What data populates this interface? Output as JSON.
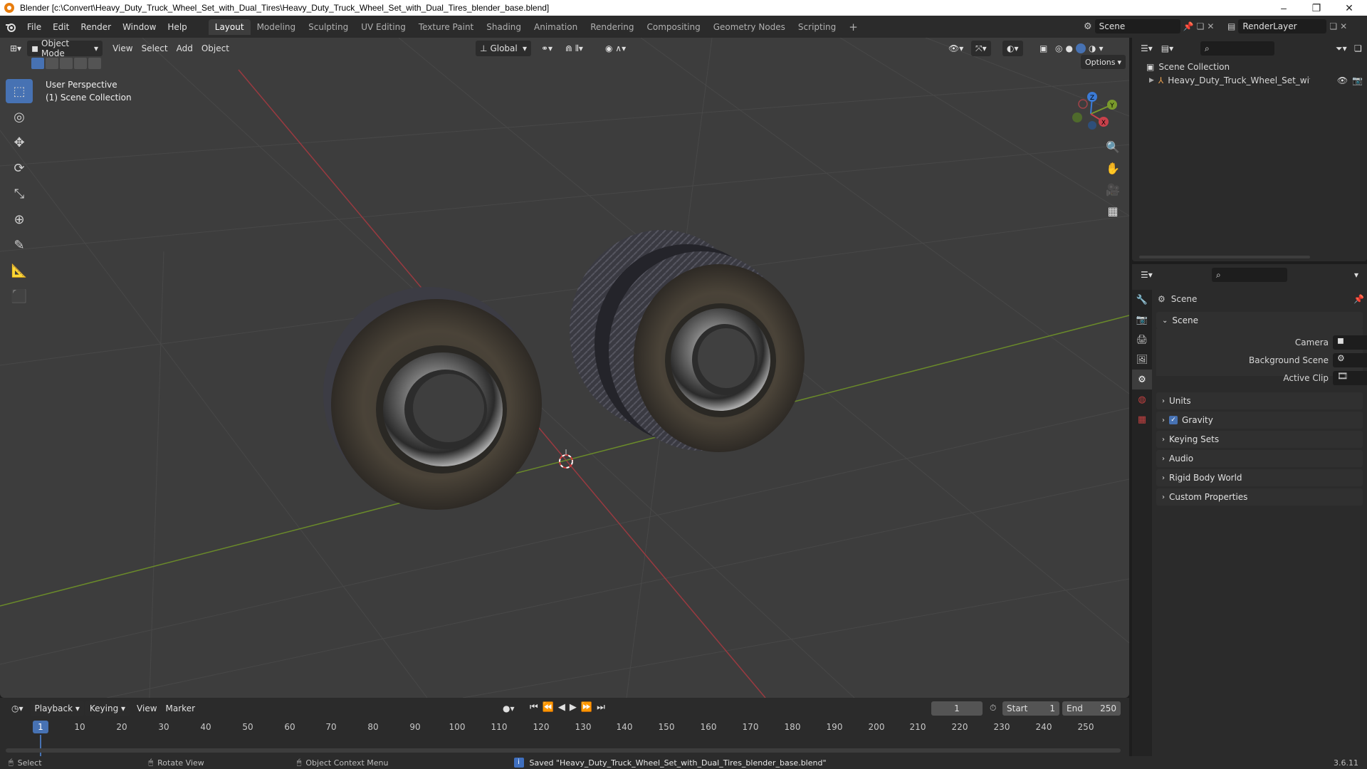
{
  "window": {
    "title": "Blender [c:\\Convert\\Heavy_Duty_Truck_Wheel_Set_with_Dual_Tires\\Heavy_Duty_Truck_Wheel_Set_with_Dual_Tires_blender_base.blend]",
    "minimize": "–",
    "maximize": "❐",
    "close": "✕"
  },
  "menus": [
    "File",
    "Edit",
    "Render",
    "Window",
    "Help"
  ],
  "workspaces": [
    "Layout",
    "Modeling",
    "Sculpting",
    "UV Editing",
    "Texture Paint",
    "Shading",
    "Animation",
    "Rendering",
    "Compositing",
    "Geometry Nodes",
    "Scripting"
  ],
  "active_workspace": "Layout",
  "add_workspace": "+",
  "scene_selector": "Scene",
  "view_layer": "RenderLayer",
  "viewport": {
    "mode": "Object Mode",
    "menus": [
      "View",
      "Select",
      "Add",
      "Object"
    ],
    "orientation": "Global",
    "options": "Options",
    "overlay_line1": "User Perspective",
    "overlay_line2": "(1) Scene Collection",
    "axis_x": "X",
    "axis_y": "Y",
    "axis_z": "Z"
  },
  "outliner": {
    "root": "Scene Collection",
    "object": "Heavy_Duty_Truck_Wheel_Set_with_Du"
  },
  "properties": {
    "context": "Scene",
    "panel_title": "Scene",
    "fields": [
      {
        "label": "Camera",
        "value": ""
      },
      {
        "label": "Background Scene",
        "value": ""
      },
      {
        "label": "Active Clip",
        "value": ""
      }
    ],
    "sections": [
      "Units",
      "Gravity",
      "Keying Sets",
      "Audio",
      "Rigid Body World",
      "Custom Properties"
    ],
    "gravity_checked": true
  },
  "timeline": {
    "menus": [
      "Playback",
      "Keying",
      "View",
      "Marker"
    ],
    "current_frame": "1",
    "start_label": "Start",
    "start": "1",
    "end_label": "End",
    "end": "250",
    "ticks": [
      "10",
      "20",
      "30",
      "40",
      "50",
      "60",
      "70",
      "80",
      "90",
      "100",
      "110",
      "120",
      "130",
      "140",
      "150",
      "160",
      "170",
      "180",
      "190",
      "200",
      "210",
      "220",
      "230",
      "240",
      "250"
    ],
    "playhead_label": "1"
  },
  "status": {
    "select": "Select",
    "rotate": "Rotate View",
    "context_menu": "Object Context Menu",
    "message": "Saved \"Heavy_Duty_Truck_Wheel_Set_with_Dual_Tires_blender_base.blend\"",
    "version": "3.6.11"
  },
  "colors": {
    "accent": "#4772b3",
    "x_axis": "#c8414b",
    "y_axis": "#7a9a2c",
    "z_axis": "#3b7bd6"
  }
}
